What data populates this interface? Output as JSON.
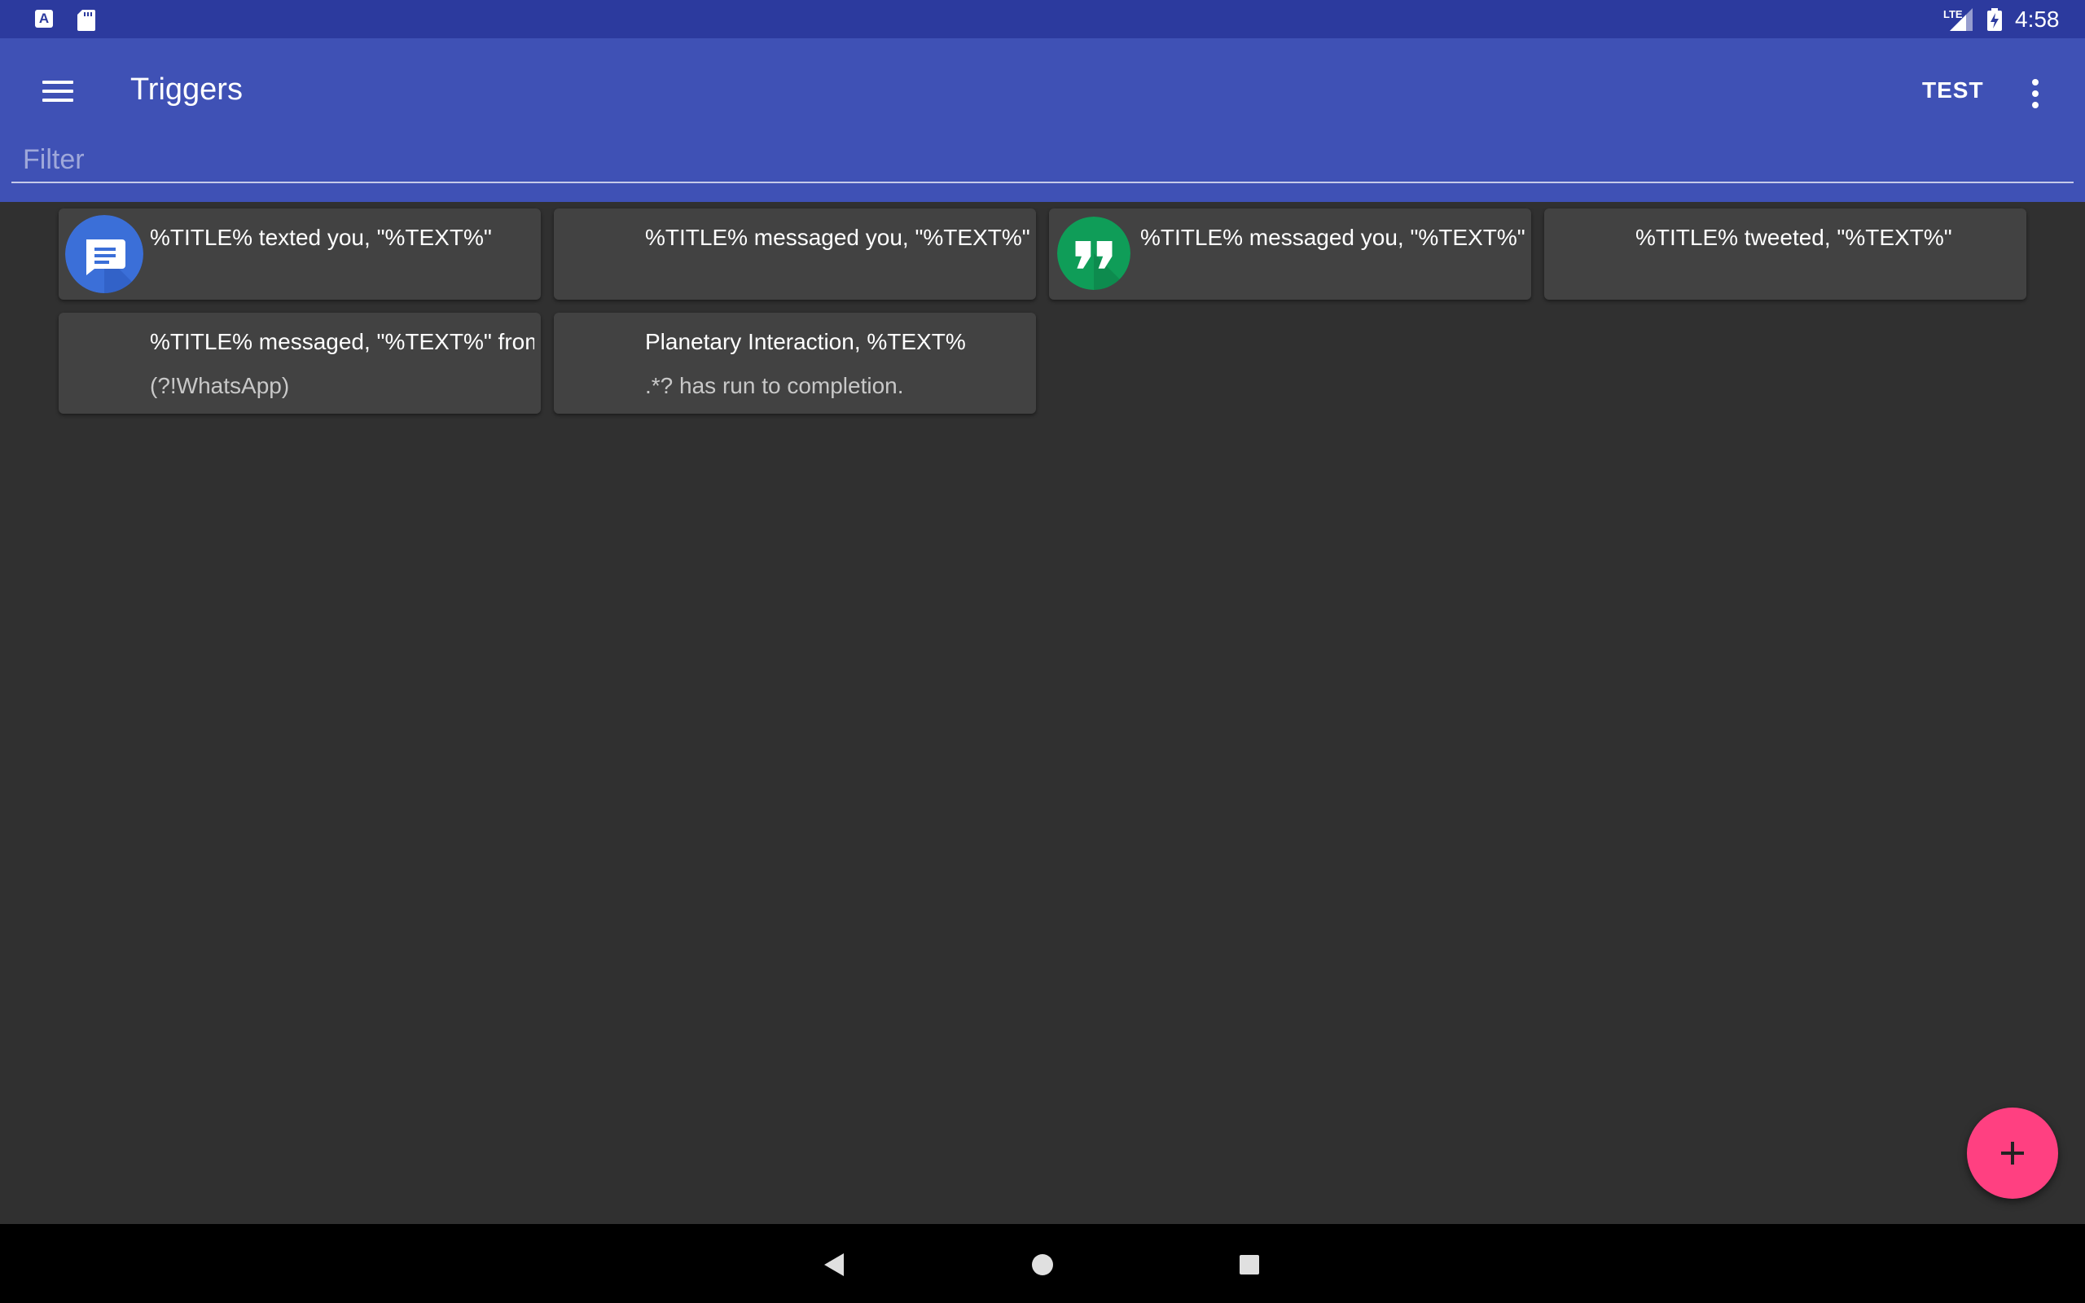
{
  "status_bar": {
    "time": "4:58",
    "network": "LTE",
    "icons": [
      "font-a-icon",
      "sd-card-icon",
      "signal-icon",
      "battery-charging-icon"
    ]
  },
  "app_bar": {
    "title": "Triggers",
    "test_label": "TEST",
    "icons": [
      "menu-icon",
      "overflow-menu-icon"
    ],
    "filter": {
      "placeholder": "Filter",
      "value": ""
    }
  },
  "cards": [
    {
      "title": "%TITLE% texted you, \"%TEXT%\"",
      "subtitle": "",
      "icon": "messages-app-icon",
      "icon_color": "#3b6fd8"
    },
    {
      "title": "%TITLE% messaged you, \"%TEXT%\"",
      "subtitle": "",
      "icon": "",
      "icon_color": ""
    },
    {
      "title": "%TITLE% messaged you, \"%TEXT%\"",
      "subtitle": "",
      "icon": "hangouts-app-icon",
      "icon_color": "#0f9d58"
    },
    {
      "title": "%TITLE% tweeted, \"%TEXT%\"",
      "subtitle": "",
      "icon": "",
      "icon_color": ""
    },
    {
      "title": "%TITLE% messaged, \"%TEXT%\" from WhatsApp",
      "subtitle": "(?!WhatsApp)",
      "icon": "",
      "icon_color": ""
    },
    {
      "title": "Planetary Interaction, %TEXT%",
      "subtitle": ".*? has run to completion.",
      "icon": "",
      "icon_color": ""
    }
  ],
  "fab": {
    "icon": "plus-icon",
    "color": "#ff4081"
  },
  "nav_bar": {
    "icons": [
      "back-icon",
      "home-icon",
      "recents-icon"
    ]
  },
  "colors": {
    "status_bar": "#2c3a9e",
    "app_bar": "#3f51b5",
    "background": "#303030",
    "card": "#424242"
  }
}
